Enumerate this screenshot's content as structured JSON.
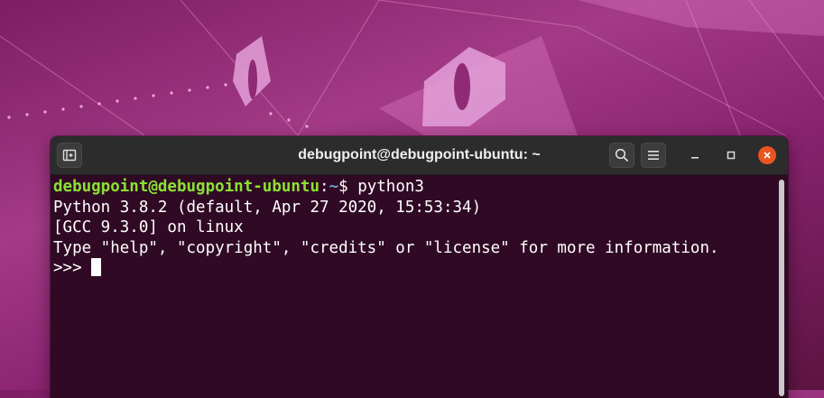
{
  "window": {
    "title": "debugpoint@debugpoint-ubuntu: ~",
    "icons": {
      "new_tab": "new-tab-icon",
      "search": "search-icon",
      "menu": "hamburger-menu-icon",
      "minimize": "minimize-icon",
      "maximize": "maximize-icon",
      "close": "close-icon"
    }
  },
  "terminal": {
    "prompt_user": "debugpoint@debugpoint-ubuntu",
    "prompt_sep": ":",
    "prompt_path": "~",
    "prompt_symbol": "$ ",
    "command": "python3",
    "output": [
      "Python 3.8.2 (default, Apr 27 2020, 15:53:34)",
      "[GCC 9.3.0] on linux",
      "Type \"help\", \"copyright\", \"credits\" or \"license\" for more information."
    ],
    "repl_prompt": ">>>"
  },
  "colors": {
    "terminal_bg": "#300a24",
    "prompt_user": "#8ae234",
    "prompt_path": "#729fcf",
    "close_button": "#e95420",
    "titlebar": "#2c2c2c"
  }
}
